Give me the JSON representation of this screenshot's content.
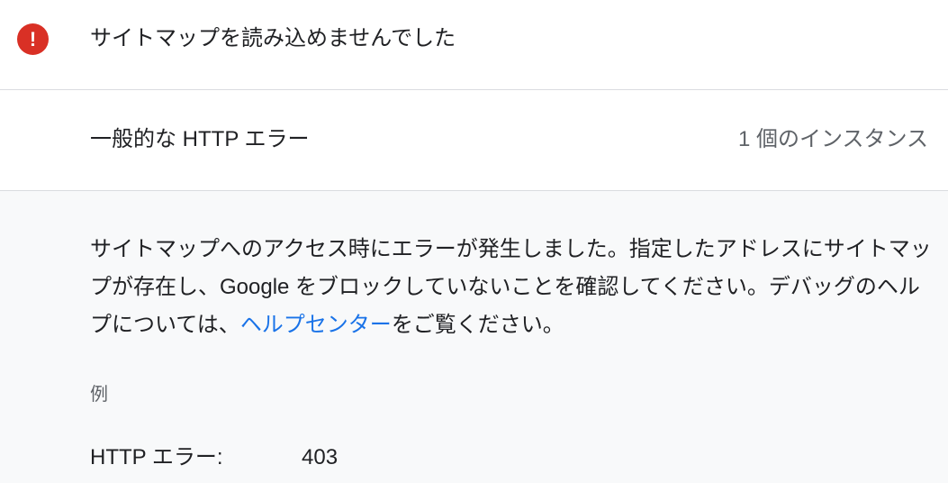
{
  "header": {
    "icon": "error-exclamation-icon",
    "icon_glyph": "!",
    "icon_color": "#d93025",
    "title": "サイトマップを読み込めませんでした"
  },
  "issue": {
    "title": "一般的な HTTP エラー",
    "count": "1 個のインスタンス"
  },
  "detail": {
    "line1": "サイトマップへのアクセス時にエラーが発生しました。指定したアドレスにサイトマッ",
    "line2": "プが存在し、Google をブロックしていないことを確認してください。デバッグのヘル",
    "line3_before": "プについては、",
    "help_link": "ヘルプセンター",
    "line3_after": "をご覧ください。",
    "link_color": "#1a73e8"
  },
  "example": {
    "label": "例",
    "key": "HTTP エラー:",
    "value": "403"
  }
}
